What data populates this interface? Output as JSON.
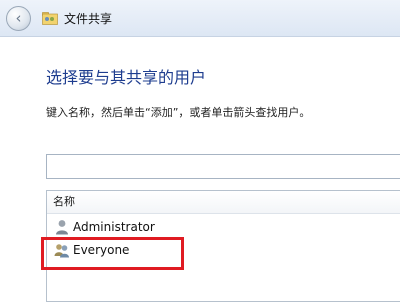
{
  "window": {
    "title": "文件共享",
    "back_button_glyph": "‹"
  },
  "main": {
    "heading": "选择要与其共享的用户",
    "instruction": "键入名称，然后单击“添加”，或者单击箭头查找用户。",
    "input": {
      "value": "",
      "placeholder": ""
    }
  },
  "user_list": {
    "header": "名称",
    "items": [
      {
        "label": "Administrator",
        "icon": "user-icon"
      },
      {
        "label": "Everyone",
        "icon": "users-group-icon"
      }
    ]
  },
  "annotation": {
    "color": "#e01b22"
  },
  "colors": {
    "heading": "#1e3d8f",
    "titlebar": "#dde7f4"
  }
}
